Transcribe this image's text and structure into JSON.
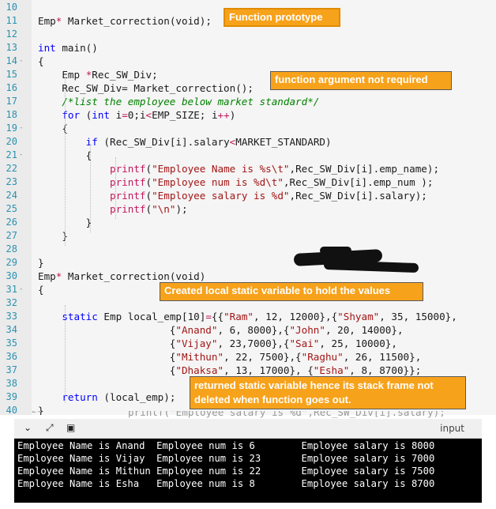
{
  "editor": {
    "lines": [
      {
        "n": "10",
        "fold": "",
        "parts": []
      },
      {
        "n": "11",
        "fold": "",
        "parts": [
          [
            "t",
            "Emp"
          ],
          [
            "o",
            "*"
          ],
          [
            "t",
            " Market_correction(void);"
          ]
        ]
      },
      {
        "n": "12",
        "fold": "",
        "parts": []
      },
      {
        "n": "13",
        "fold": "",
        "parts": [
          [
            "k",
            "int"
          ],
          [
            "t",
            " main()"
          ]
        ]
      },
      {
        "n": "14",
        "fold": "-",
        "parts": [
          [
            "t",
            "{"
          ]
        ]
      },
      {
        "n": "15",
        "fold": "",
        "parts": [
          [
            "t",
            "    Emp "
          ],
          [
            "o",
            "*"
          ],
          [
            "t",
            "Rec_SW_Div;"
          ]
        ]
      },
      {
        "n": "16",
        "fold": "",
        "parts": [
          [
            "t",
            "    Rec_SW_Div= Market_correction();"
          ]
        ]
      },
      {
        "n": "17",
        "fold": "",
        "parts": [
          [
            "c",
            "    /*list the employee below market standard*/"
          ]
        ]
      },
      {
        "n": "18",
        "fold": "",
        "parts": [
          [
            "t",
            "    "
          ],
          [
            "k",
            "for"
          ],
          [
            "t",
            " ("
          ],
          [
            "k",
            "int"
          ],
          [
            "t",
            " i"
          ],
          [
            "o",
            "="
          ],
          [
            "t",
            "0;i"
          ],
          [
            "o",
            "<"
          ],
          [
            "t",
            "EMP_SIZE; i"
          ],
          [
            "o",
            "++"
          ],
          [
            "t",
            ")"
          ]
        ]
      },
      {
        "n": "19",
        "fold": "-",
        "parts": [
          [
            "t",
            "    {"
          ]
        ]
      },
      {
        "n": "20",
        "fold": "",
        "parts": [
          [
            "t",
            "        "
          ],
          [
            "k",
            "if"
          ],
          [
            "t",
            " (Rec_SW_Div[i].salary"
          ],
          [
            "o",
            "<"
          ],
          [
            "t",
            "MARKET_STANDARD)"
          ]
        ]
      },
      {
        "n": "21",
        "fold": "-",
        "parts": [
          [
            "t",
            "        {"
          ]
        ]
      },
      {
        "n": "22",
        "fold": "",
        "parts": [
          [
            "t",
            "            "
          ],
          [
            "p",
            "printf"
          ],
          [
            "t",
            "("
          ],
          [
            "s",
            "\"Employee Name is %s\\t\""
          ],
          [
            "t",
            ",Rec_SW_Div[i].emp_name);"
          ]
        ]
      },
      {
        "n": "23",
        "fold": "",
        "parts": [
          [
            "t",
            "            "
          ],
          [
            "p",
            "printf"
          ],
          [
            "t",
            "("
          ],
          [
            "s",
            "\"Employee num is %d\\t\""
          ],
          [
            "t",
            ",Rec_SW_Div[i].emp_num );"
          ]
        ]
      },
      {
        "n": "24",
        "fold": "",
        "parts": [
          [
            "t",
            "            "
          ],
          [
            "p",
            "printf"
          ],
          [
            "t",
            "("
          ],
          [
            "s",
            "\"Employee salary is %d\""
          ],
          [
            "t",
            ",Rec_SW_Div[i].salary);"
          ]
        ]
      },
      {
        "n": "25",
        "fold": "",
        "parts": [
          [
            "t",
            "            "
          ],
          [
            "p",
            "printf"
          ],
          [
            "t",
            "("
          ],
          [
            "s",
            "\"\\n\""
          ],
          [
            "t",
            ");"
          ]
        ]
      },
      {
        "n": "26",
        "fold": "",
        "parts": [
          [
            "t",
            "        }"
          ]
        ]
      },
      {
        "n": "27",
        "fold": "",
        "parts": [
          [
            "t",
            "    }"
          ]
        ]
      },
      {
        "n": "28",
        "fold": "",
        "parts": []
      },
      {
        "n": "29",
        "fold": "",
        "parts": [
          [
            "t",
            "}"
          ]
        ]
      },
      {
        "n": "30",
        "fold": "",
        "parts": [
          [
            "t",
            "Emp"
          ],
          [
            "o",
            "*"
          ],
          [
            "t",
            " Market_correction(void)"
          ]
        ]
      },
      {
        "n": "31",
        "fold": "-",
        "parts": [
          [
            "t",
            "{"
          ]
        ]
      },
      {
        "n": "32",
        "fold": "",
        "parts": []
      },
      {
        "n": "33",
        "fold": "",
        "parts": [
          [
            "t",
            "    "
          ],
          [
            "k",
            "static"
          ],
          [
            "t",
            " Emp local_emp[10]"
          ],
          [
            "o",
            "="
          ],
          [
            "t",
            "{{"
          ],
          [
            "s",
            "\"Ram\""
          ],
          [
            "t",
            ", 12, 12000},{"
          ],
          [
            "s",
            "\"Shyam\""
          ],
          [
            "t",
            ", 35, 15000},"
          ]
        ]
      },
      {
        "n": "34",
        "fold": "",
        "parts": [
          [
            "t",
            "                      {"
          ],
          [
            "s",
            "\"Anand\""
          ],
          [
            "t",
            ", 6, 8000},{"
          ],
          [
            "s",
            "\"John\""
          ],
          [
            "t",
            ", 20, 14000},"
          ]
        ]
      },
      {
        "n": "35",
        "fold": "",
        "parts": [
          [
            "t",
            "                      {"
          ],
          [
            "s",
            "\"Vijay\""
          ],
          [
            "t",
            ", 23,7000},{"
          ],
          [
            "s",
            "\"Sai\""
          ],
          [
            "t",
            ", 25, 10000},"
          ]
        ]
      },
      {
        "n": "36",
        "fold": "",
        "parts": [
          [
            "t",
            "                      {"
          ],
          [
            "s",
            "\"Mithun\""
          ],
          [
            "t",
            ", 22, 7500},{"
          ],
          [
            "s",
            "\"Raghu\""
          ],
          [
            "t",
            ", 26, 11500},"
          ]
        ]
      },
      {
        "n": "37",
        "fold": "",
        "parts": [
          [
            "t",
            "                      {"
          ],
          [
            "s",
            "\"Dhaksa\""
          ],
          [
            "t",
            ", 13, 17000}, {"
          ],
          [
            "s",
            "\"Esha\""
          ],
          [
            "t",
            ", 8, 8700}};"
          ]
        ]
      },
      {
        "n": "38",
        "fold": "",
        "parts": []
      },
      {
        "n": "39",
        "fold": "",
        "parts": [
          [
            "t",
            "    "
          ],
          [
            "k",
            "return"
          ],
          [
            "t",
            " (local_emp);"
          ]
        ]
      },
      {
        "n": "40",
        "fold": "",
        "parts": [
          [
            "t",
            "}"
          ]
        ]
      }
    ]
  },
  "annotations": {
    "prototype": "Function prototype",
    "arg_not_required": "function argument not required",
    "static_var": "Created local static variable to hold the values",
    "returned_static_1": "returned static variable hence its stack frame not",
    "returned_static_2": "deleted when function goes out."
  },
  "console": {
    "toolbar_label": "input",
    "toolbar_icons": [
      "chevron-down-icon",
      "expand-icon",
      "copy-icon"
    ],
    "overlap_text": "printf(\"Employee salary is %d\",Rec_SW_Div[i].salary);",
    "overlap_line_no": "24",
    "lines": [
      "Employee Name is Anand  Employee num is 6        Employee salary is 8000",
      "Employee Name is Vijay  Employee num is 23       Employee salary is 7000",
      "Employee Name is Mithun Employee num is 22       Employee salary is 7500",
      "Employee Name is Esha   Employee num is 8        Employee salary is 8700"
    ]
  }
}
